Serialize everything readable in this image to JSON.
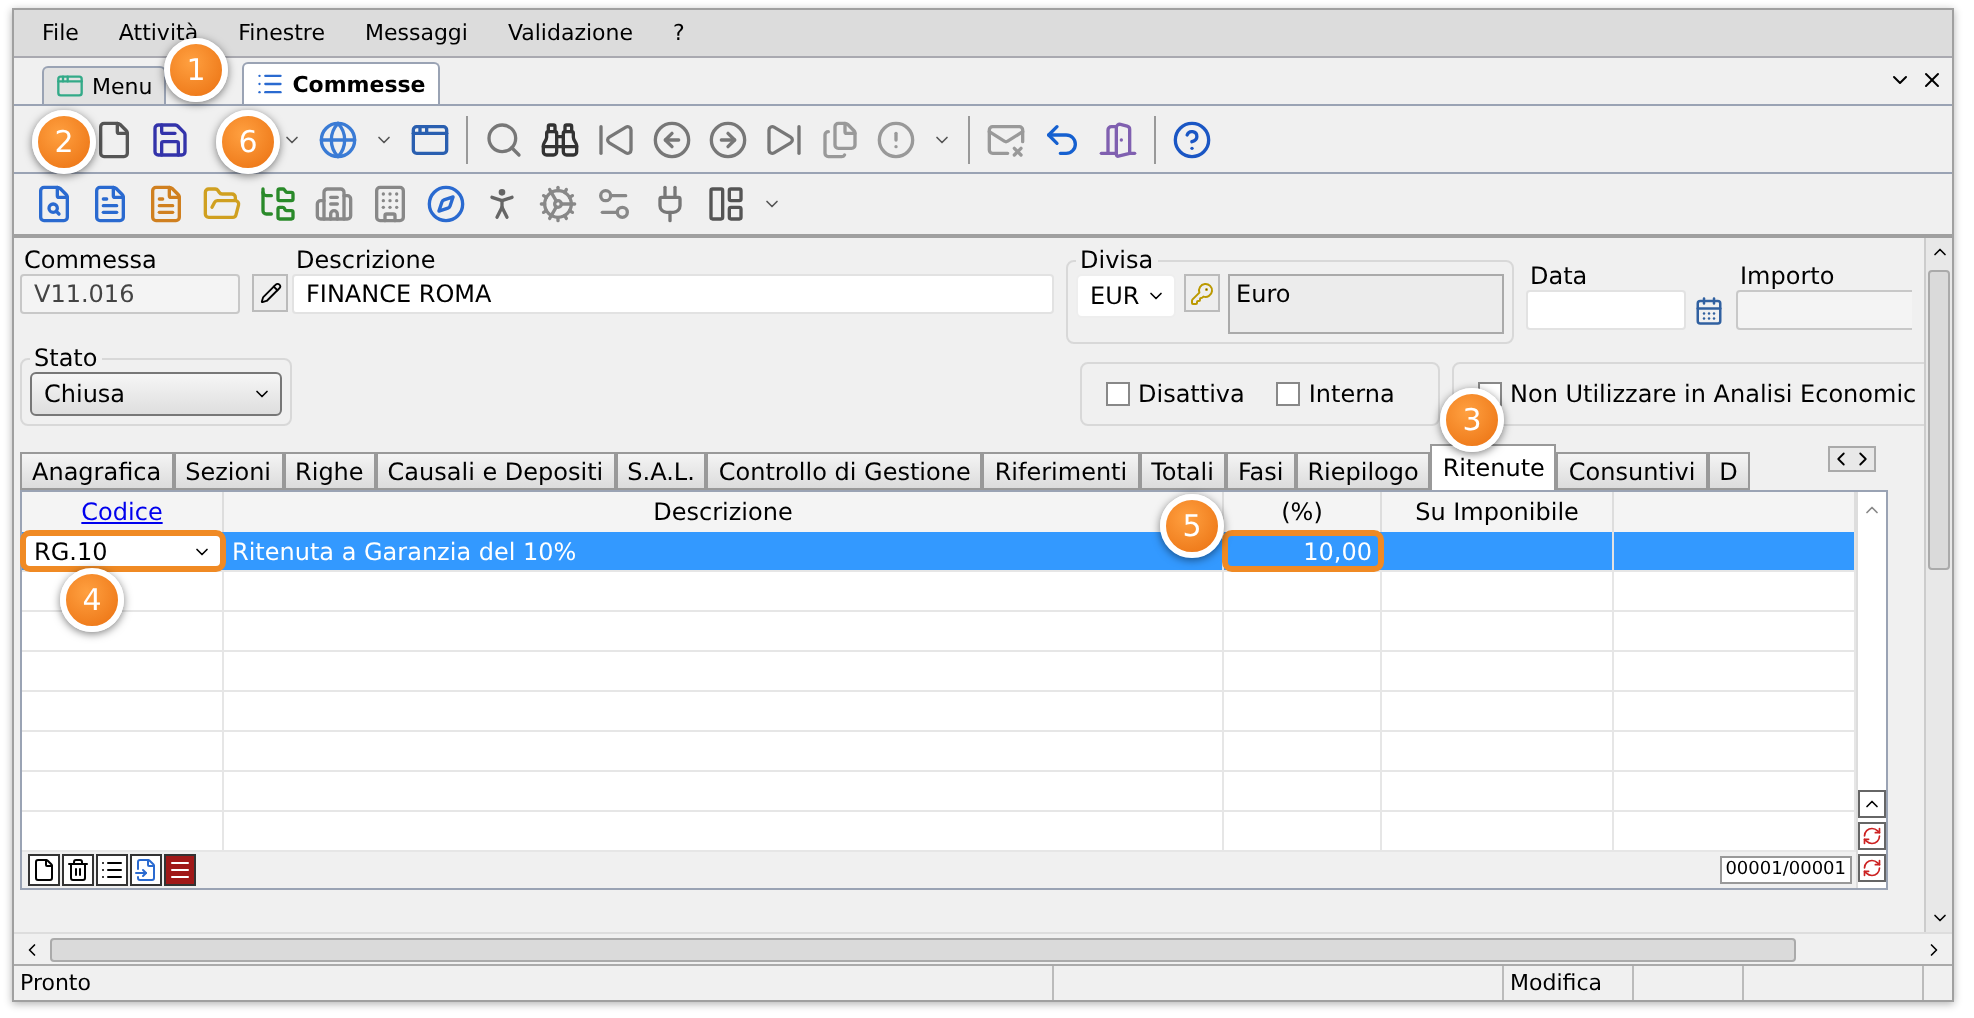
{
  "menu": [
    "File",
    "Attività",
    "Finestre",
    "Messaggi",
    "Validazione",
    "?"
  ],
  "document_tabs": [
    {
      "label": "Menu",
      "selected": false
    },
    {
      "label": "Commesse",
      "selected": true
    }
  ],
  "form": {
    "commessa": {
      "label": "Commessa",
      "value": "V11.016"
    },
    "descrizione": {
      "label": "Descrizione",
      "value": "FINANCE ROMA"
    },
    "divisa": {
      "label": "Divisa",
      "value": "EUR",
      "name": "Euro"
    },
    "data": {
      "label": "Data"
    },
    "importo": {
      "label": "Importo"
    },
    "stato": {
      "label": "Stato",
      "value": "Chiusa"
    },
    "checkboxes": [
      {
        "label": "Disattiva",
        "checked": false
      },
      {
        "label": "Interna",
        "checked": false
      },
      {
        "label": "Non Utilizzare in Analisi Economic",
        "checked": false
      }
    ]
  },
  "section_tabs": [
    {
      "label": "Anagrafica",
      "selected": false
    },
    {
      "label": "Sezioni",
      "selected": false
    },
    {
      "label": "Righe",
      "selected": false
    },
    {
      "label": "Causali e Depositi",
      "selected": false
    },
    {
      "label": "S.A.L.",
      "selected": false
    },
    {
      "label": "Controllo di Gestione",
      "selected": false
    },
    {
      "label": "Riferimenti",
      "selected": false
    },
    {
      "label": "Totali",
      "selected": false
    },
    {
      "label": "Fasi",
      "selected": false
    },
    {
      "label": "Riepilogo",
      "selected": false
    },
    {
      "label": "Ritenute",
      "selected": true
    },
    {
      "label": "Consuntivi",
      "selected": false
    },
    {
      "label": "D",
      "selected": false
    }
  ],
  "grid": {
    "columns": [
      "Codice",
      "Descrizione",
      "(%)",
      "Su Imponibile"
    ],
    "rows": [
      {
        "selected": true,
        "cells": [
          {
            "text": "RG.10",
            "highlighted": true
          },
          {
            "text": "Ritenuta a Garanzia del 10%",
            "highlighted": false
          },
          {
            "text": "10,00",
            "highlighted": true
          },
          {
            "text": "",
            "highlighted": false
          }
        ]
      }
    ],
    "record_counter": "00001/00001"
  },
  "status_bar": [
    "Pronto",
    "Modifica"
  ],
  "callouts": [
    "1",
    "2",
    "6",
    "3",
    "4",
    "5"
  ]
}
